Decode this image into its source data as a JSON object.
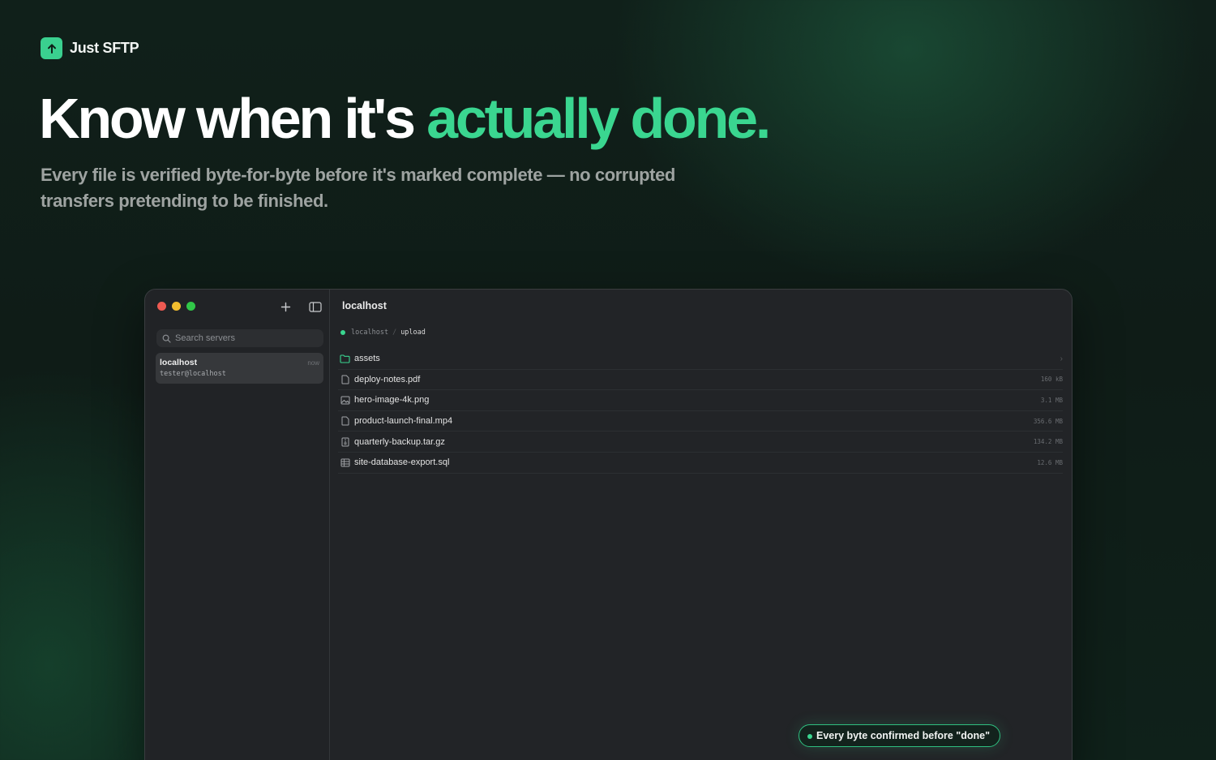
{
  "brand": {
    "name": "Just SFTP",
    "icon": "arrow-up-icon",
    "accent": "#3ad08f"
  },
  "hero": {
    "headline_main": "Know when it's ",
    "headline_accent": "actually done.",
    "subhead": "Every file is verified byte-for-byte before it's marked complete — no corrupted transfers pretending to be finished."
  },
  "window": {
    "sidebar": {
      "search_placeholder": "Search servers",
      "servers": [
        {
          "name": "localhost",
          "user": "tester@localhost",
          "time": "now"
        }
      ]
    },
    "main": {
      "title": "localhost",
      "breadcrumb": {
        "root": "localhost",
        "separator": "/",
        "current": "upload"
      },
      "files": [
        {
          "name": "assets",
          "icon": "folder-icon",
          "size": "",
          "is_folder": true
        },
        {
          "name": "deploy-notes.pdf",
          "icon": "file-icon",
          "size": "160 kB"
        },
        {
          "name": "hero-image-4k.png",
          "icon": "image-icon",
          "size": "3.1 MB"
        },
        {
          "name": "product-launch-final.mp4",
          "icon": "file-icon",
          "size": "356.6 MB"
        },
        {
          "name": "quarterly-backup.tar.gz",
          "icon": "archive-icon",
          "size": "134.2 MB"
        },
        {
          "name": "site-database-export.sql",
          "icon": "table-icon",
          "size": "12.6 MB"
        }
      ]
    }
  },
  "badge": {
    "text": "Every byte confirmed before \"done\""
  },
  "colors": {
    "accent": "#3ad690",
    "window_bg": "#222427"
  }
}
